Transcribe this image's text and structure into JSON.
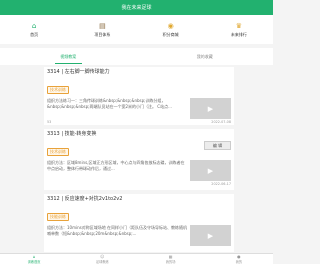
{
  "title_bar": "我在未来足球",
  "top_nav": [
    {
      "label": "首页",
      "icon": "home-icon"
    },
    {
      "label": "项目体系",
      "icon": "book-icon"
    },
    {
      "label": "积分商城",
      "icon": "coin-icon"
    },
    {
      "label": "未来排行",
      "icon": "trophy-icon"
    }
  ],
  "tabs": [
    {
      "label": "视频教案",
      "active": true
    },
    {
      "label": "我的收藏",
      "active": false
    }
  ],
  "cards": [
    {
      "title": "3314 | 左右脚一脚传球能力",
      "badge": "技术训练",
      "text": "组织方法练习一：三角传球训练&nbsp;&nbsp;&nbsp;训练分组，&nbsp;&nbsp;&nbsp;两端队员站在一个宽2米的小门（注。 C站点...",
      "meta_left": "53",
      "meta_right": "2022-07-08"
    },
    {
      "title": "3313 | 技能-转身变换",
      "badge": "技术训练",
      "edit_label": "编 辑",
      "text": "组织方法：区域8mins,区域正方形区域，中心点与四角各放标志碟，训练者在中点启动，整体行带球动作后，通过...",
      "meta_left": "",
      "meta_right": "2022-06-17"
    },
    {
      "title": "3312 | 反应速度+对抗2v1to2v2",
      "badge": "技能训练",
      "text": "组织方法：10mins对称区域场地 在同样小门（距队伍及守场导标站、教练随机喊单数（短&nbsp;&nbsp;20m&nbsp;&nbsp;..."
    }
  ],
  "bottom_nav": [
    {
      "label": "训练首页",
      "icon": "training-home-icon",
      "active": true
    },
    {
      "label": "足球教练",
      "icon": "coach-icon",
      "active": false
    },
    {
      "label": "我的场",
      "icon": "field-icon",
      "active": false
    },
    {
      "label": "我的",
      "icon": "profile-icon",
      "active": false
    }
  ],
  "colors": {
    "accent": "#22b16f",
    "badge": "#e8a23a",
    "background": "#f4f4f4"
  }
}
